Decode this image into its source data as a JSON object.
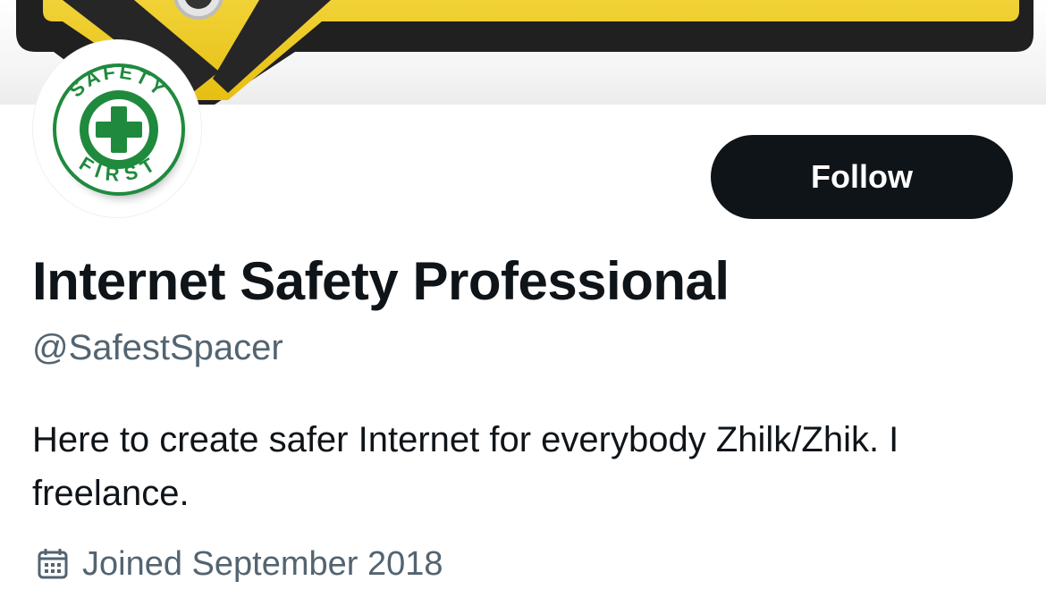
{
  "profile": {
    "display_name": "Internet Safety Professional",
    "handle": "@SafestSpacer",
    "bio": "Here to create safer Internet for everybody Zhilk/Zhik. I freelance.",
    "joined": "Joined September 2018",
    "follow_label": "Follow"
  },
  "icons": {
    "avatar": "safety-first-logo",
    "joined": "calendar-icon"
  },
  "avatar_logo": {
    "top_text": "SAFETY",
    "bottom_text": "FIRST"
  },
  "colors": {
    "banner_yellow": "#e9c31d",
    "logo_green": "#1f8a3d",
    "button_bg": "#0f1419",
    "secondary_text": "#536471"
  }
}
